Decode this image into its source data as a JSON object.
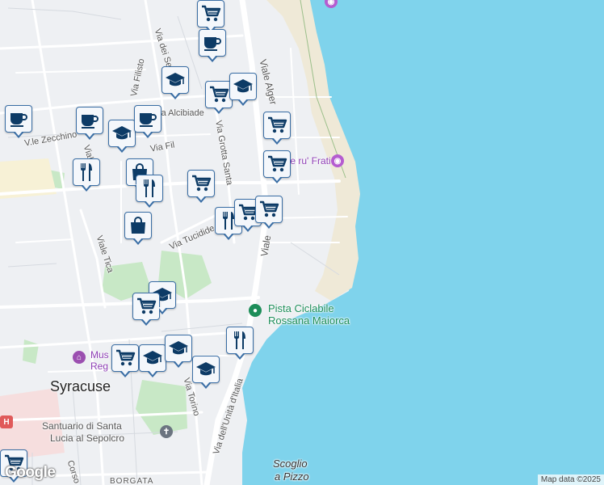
{
  "map": {
    "attribution": "Map data ©2025",
    "logo": "Google",
    "streets": [
      "Via dei Se",
      "Viale Alger",
      "Via Filisto",
      "Via Alcibiade",
      "V.le Zecchino",
      "Viale",
      "Via Fil",
      "Via Grotta Santa",
      "Via Tucidide",
      "Viale Tica",
      "Viale",
      "Via Torino",
      "Via dell'Unità d'Italia",
      "Corso"
    ],
    "places": {
      "city": "Syracuse",
      "beach": "Scalo e ru' Frati",
      "bike_path_line1": "Pista Ciclabile",
      "bike_path_line2": "Rossana Maiorca",
      "museum_line1": "Mus",
      "museum_line2": "Reg",
      "sanctuary_line1": "Santuario di Santa",
      "sanctuary_line2": "Lucia al Sepolcro",
      "rock_line1": "Scoglio",
      "rock_line2": "a Pizzo",
      "district": "BORGATA"
    },
    "colors": {
      "sea": "#7fd3ec",
      "land": "#eef0f3",
      "sand": "#efe9d7",
      "park": "#c8e8c6",
      "road": "#ffffff",
      "marker_border": "#3a6ea5",
      "marker_icon": "#0d3b66"
    },
    "markers": [
      {
        "icon": "shopping-cart-icon"
      },
      {
        "icon": "coffee-cup-icon"
      },
      {
        "icon": "graduation-cap-icon"
      },
      {
        "icon": "shopping-cart-icon"
      },
      {
        "icon": "graduation-cap-icon"
      },
      {
        "icon": "coffee-cup-icon"
      },
      {
        "icon": "coffee-cup-icon"
      },
      {
        "icon": "graduation-cap-icon"
      },
      {
        "icon": "coffee-cup-icon"
      },
      {
        "icon": "shopping-cart-icon"
      },
      {
        "icon": "shopping-cart-icon"
      },
      {
        "icon": "fork-knife-icon"
      },
      {
        "icon": "shopping-bag-icon"
      },
      {
        "icon": "fork-knife-icon"
      },
      {
        "icon": "shopping-cart-icon"
      },
      {
        "icon": "fork-knife-icon"
      },
      {
        "icon": "shopping-cart-icon"
      },
      {
        "icon": "shopping-cart-icon"
      },
      {
        "icon": "shopping-bag-icon"
      },
      {
        "icon": "graduation-cap-icon"
      },
      {
        "icon": "shopping-cart-icon"
      },
      {
        "icon": "fork-knife-icon"
      },
      {
        "icon": "shopping-cart-icon"
      },
      {
        "icon": "graduation-cap-icon"
      },
      {
        "icon": "graduation-cap-icon"
      },
      {
        "icon": "graduation-cap-icon"
      },
      {
        "icon": "shopping-cart-icon"
      }
    ]
  }
}
